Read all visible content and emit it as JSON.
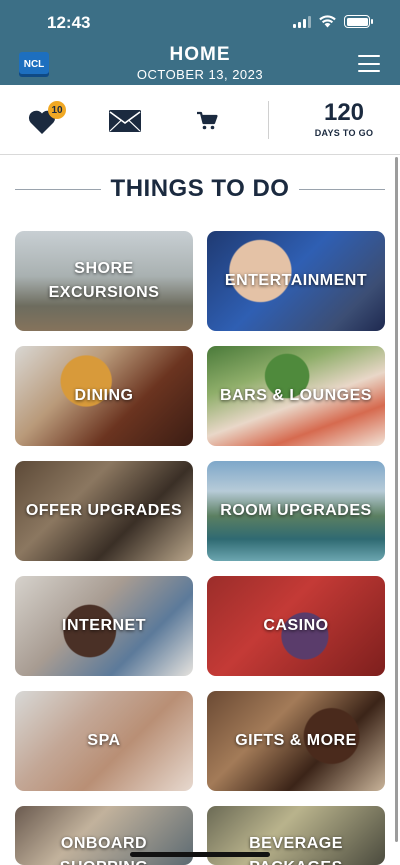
{
  "status_bar": {
    "time": "12:43"
  },
  "header": {
    "logo_text": "NCL",
    "title": "HOME",
    "date": "OCTOBER 13, 2023",
    "background": "#3c6f86"
  },
  "action_bar": {
    "favorites_count": "10",
    "countdown_value": "120",
    "countdown_label": "DAYS TO GO",
    "accent": "#1b2a3f",
    "badge_color": "#f0a824"
  },
  "section": {
    "heading": "THINGS TO DO"
  },
  "tiles": [
    {
      "label": "SHORE EXCURSIONS"
    },
    {
      "label": "ENTERTAINMENT"
    },
    {
      "label": "DINING"
    },
    {
      "label": "BARS & LOUNGES"
    },
    {
      "label": "OFFER UPGRADES"
    },
    {
      "label": "ROOM UPGRADES"
    },
    {
      "label": "INTERNET"
    },
    {
      "label": "CASINO"
    },
    {
      "label": "SPA"
    },
    {
      "label": "GIFTS & MORE"
    },
    {
      "label": "ONBOARD SHOPPING"
    },
    {
      "label": "BEVERAGE PACKAGES"
    }
  ],
  "icons": {
    "favorites": "heart-icon",
    "messages": "envelope-icon",
    "cart": "cart-icon",
    "menu": "hamburger-menu-icon",
    "wifi": "wifi-icon",
    "signal": "cellular-signal-icon",
    "battery": "battery-icon"
  }
}
